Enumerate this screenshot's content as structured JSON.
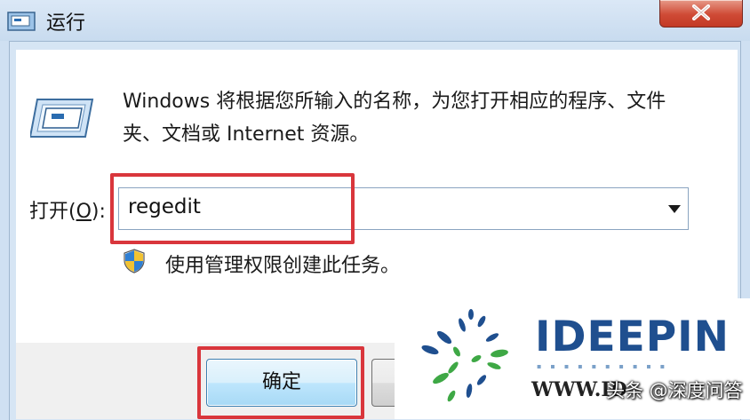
{
  "window": {
    "title": "运行",
    "close_glyph": "✕"
  },
  "content": {
    "description": "Windows 将根据您所输入的名称，为您打开相应的程序、文件夹、文档或 Internet 资源。",
    "open_label_prefix": "打开(",
    "open_label_accel": "O",
    "open_label_suffix": "):",
    "command_value": "regedit",
    "admin_note": "使用管理权限创建此任务。"
  },
  "buttons": {
    "ok_label": "确定"
  },
  "watermark": {
    "brand": "IDEEPIN",
    "url": "WWW.ID",
    "overlay": "头条 @深度问答"
  },
  "colors": {
    "highlight": "#d9363c",
    "brand": "#1f4f8f",
    "close": "#c33a26"
  },
  "icons": [
    "run-dialog-icon",
    "close-icon",
    "dropdown-arrow-icon",
    "uac-shield-icon"
  ]
}
